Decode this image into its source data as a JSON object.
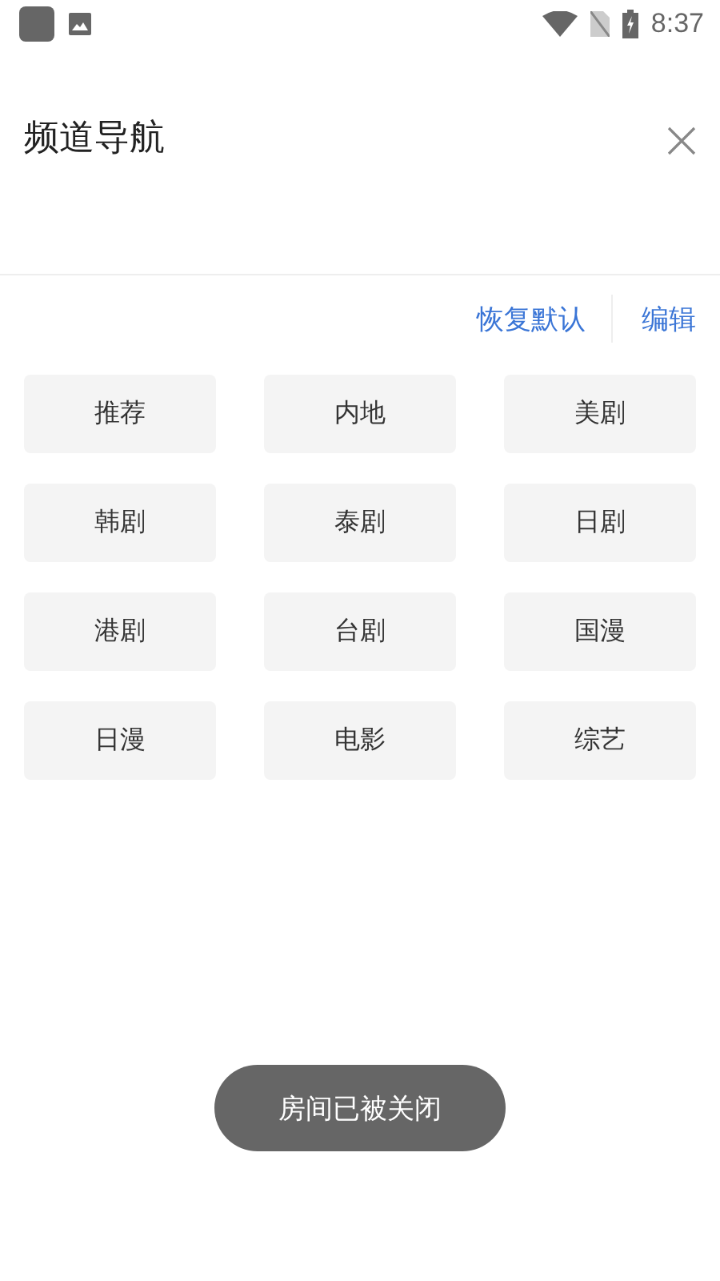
{
  "status_bar": {
    "time": "8:37"
  },
  "header": {
    "title": "频道导航"
  },
  "actions": [
    "恢复默认",
    "编辑"
  ],
  "channels": [
    "推荐",
    "内地",
    "美剧",
    "韩剧",
    "泰剧",
    "日剧",
    "港剧",
    "台剧",
    "国漫",
    "日漫",
    "电影",
    "综艺"
  ],
  "toast": "房间已被关闭"
}
